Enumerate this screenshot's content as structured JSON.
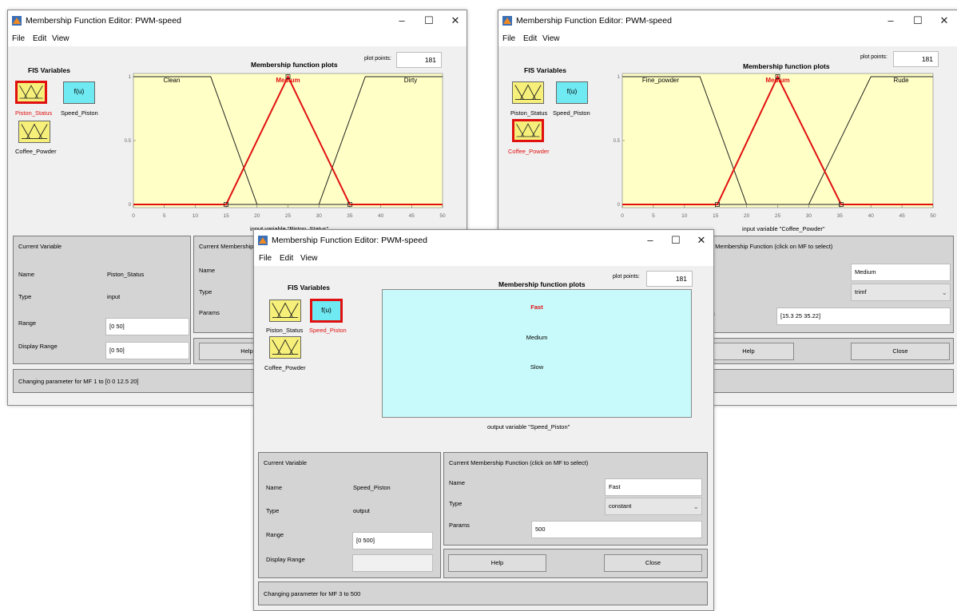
{
  "colors": {
    "input_bg": "#f6f07a",
    "output_bg": "#6fe9f2",
    "selected": "#e01010",
    "plot_in": "#ffffc6",
    "plot_out": "#c9fafb"
  },
  "fis_title": "FIS Variables",
  "var_out_icon": "f(u)",
  "mfp_title": "Membership function plots",
  "plot_points_label": "plot points:",
  "menu": {
    "file": "File",
    "edit": "Edit",
    "view": "View"
  },
  "win1": {
    "title": "Membership Function Editor: PWM-speed",
    "plot_points": "181",
    "vars": {
      "piston": "Piston_Status",
      "speed": "Speed_Piston",
      "coffee": "Coffee_Powder"
    },
    "xaxis_caption": "input variable \"Piston_Status\"",
    "mfs": [
      "Clean",
      "Medium",
      "Dirty"
    ],
    "current_variable": {
      "title": "Current Variable",
      "name_label": "Name",
      "name_value": "Piston_Status",
      "type_label": "Type",
      "type_value": "input",
      "range_label": "Range",
      "range_value": "[0 50]",
      "display_label": "Display Range",
      "display_value": "[0 50]"
    },
    "mf_panel": {
      "title": "Current Membership",
      "name_label": "Name",
      "type_label": "Type",
      "params_label": "Params"
    },
    "help": "Help",
    "status": "Changing parameter for MF 1 to  [0 0 12.5 20]"
  },
  "win2": {
    "title": "Membership Function Editor: PWM-speed",
    "plot_points": "181",
    "vars": {
      "piston": "Piston_Status",
      "speed": "Speed_Piston",
      "coffee": "Coffee_Powder"
    },
    "xaxis_caption": "input variable \"Coffee_Powder\"",
    "mfs": [
      "Fine_powder",
      "Medium",
      "Rude"
    ],
    "mf_panel": {
      "title": "t Membership Function (click on MF to select)",
      "name_value": "Medium",
      "type_value": "trimf",
      "params_label": "s",
      "params_value": "[15.3 25 35.22]"
    },
    "help": "Help",
    "close": "Close"
  },
  "win3": {
    "title": "Membership Function Editor: PWM-speed",
    "plot_points": "181",
    "vars": {
      "piston": "Piston_Status",
      "speed": "Speed_Piston",
      "coffee": "Coffee_Powder"
    },
    "mf_labels": [
      "Fast",
      "Medium",
      "Slow"
    ],
    "xaxis_caption": "output variable \"Speed_Piston\"",
    "current_variable": {
      "title": "Current Variable",
      "name_label": "Name",
      "name_value": "Speed_Piston",
      "type_label": "Type",
      "type_value": "output",
      "range_label": "Range",
      "range_value": "[0 500]",
      "display_label": "Display Range",
      "display_value": ""
    },
    "mf_panel": {
      "title": "Current Membership Function (click on MF to select)",
      "name_label": "Name",
      "name_value": "Fast",
      "type_label": "Type",
      "type_value": "constant",
      "params_label": "Params",
      "params_value": "500"
    },
    "help": "Help",
    "close": "Close",
    "status": "Changing parameter for MF 3 to 500"
  },
  "chart_data": [
    {
      "type": "line",
      "xlabel": "input variable \"Piston_Status\"",
      "xlim": [
        0,
        50
      ],
      "ylim": [
        0,
        1
      ],
      "xticks": [
        0,
        5,
        10,
        15,
        20,
        25,
        30,
        35,
        40,
        45,
        50
      ],
      "yticks": [
        0,
        0.5,
        1
      ],
      "series": [
        {
          "name": "Clean",
          "x": [
            0,
            12.5,
            20,
            50
          ],
          "y": [
            1,
            1,
            0,
            0
          ],
          "selected": false
        },
        {
          "name": "Medium",
          "x": [
            0,
            15,
            25,
            35,
            50
          ],
          "y": [
            0,
            0,
            1,
            0,
            0
          ],
          "selected": true
        },
        {
          "name": "Dirty",
          "x": [
            0,
            30,
            37.5,
            50
          ],
          "y": [
            0,
            0,
            1,
            1
          ],
          "selected": false
        }
      ]
    },
    {
      "type": "line",
      "xlabel": "input variable \"Coffee_Powder\"",
      "xlim": [
        0,
        50
      ],
      "ylim": [
        0,
        1
      ],
      "xticks": [
        0,
        5,
        10,
        15,
        20,
        25,
        30,
        35,
        40,
        45,
        50
      ],
      "yticks": [
        0,
        0.5,
        1
      ],
      "series": [
        {
          "name": "Fine_powder",
          "x": [
            0,
            12.5,
            20,
            50
          ],
          "y": [
            1,
            1,
            0,
            0
          ],
          "selected": false
        },
        {
          "name": "Medium",
          "x": [
            0,
            15.3,
            25,
            35.22,
            50
          ],
          "y": [
            0,
            0,
            1,
            0,
            0
          ],
          "selected": true
        },
        {
          "name": "Rude",
          "x": [
            0,
            30,
            40,
            50
          ],
          "y": [
            0,
            0,
            1,
            1
          ],
          "selected": false
        }
      ]
    }
  ]
}
